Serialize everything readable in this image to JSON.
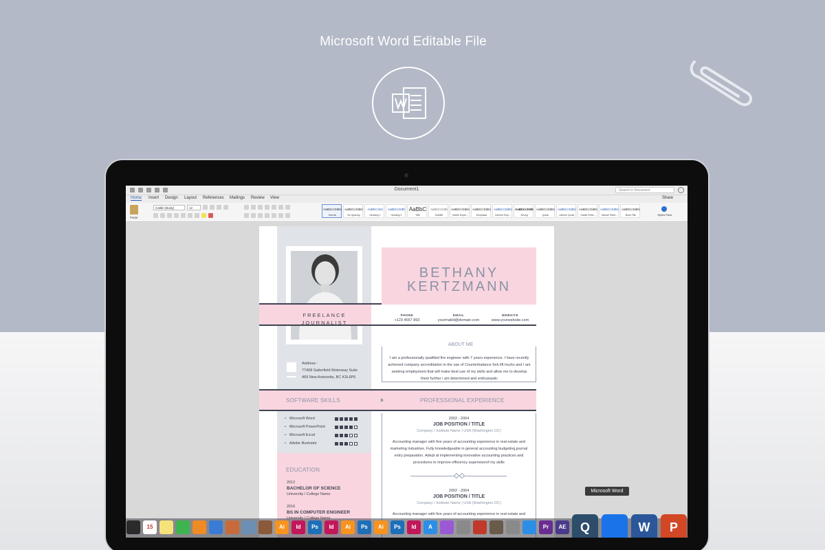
{
  "promo": {
    "headline": "Microsoft Word Editable File"
  },
  "app": {
    "document_title": "Document1",
    "search_placeholder": "Search in Document",
    "share_label": "Share",
    "tabs": [
      {
        "label": "Home"
      },
      {
        "label": "Insert"
      },
      {
        "label": "Design"
      },
      {
        "label": "Layout"
      },
      {
        "label": "References"
      },
      {
        "label": "Mailings"
      },
      {
        "label": "Review"
      },
      {
        "label": "View"
      }
    ],
    "paste_label": "Paste",
    "font_name": "Calibri (Body)",
    "font_size": "12",
    "styles": [
      {
        "sample": "AaBbCcDdEe",
        "name": "Normal"
      },
      {
        "sample": "AaBbCcDdEe",
        "name": "No Spacing"
      },
      {
        "sample": "AaBbCcDd",
        "name": "Heading 1"
      },
      {
        "sample": "AaBbCcDdE",
        "name": "Heading 2"
      },
      {
        "sample": "AaBbC",
        "name": "Title"
      },
      {
        "sample": "AaBbCcDdE",
        "name": "Subtitle"
      },
      {
        "sample": "AaBbCcDdEe",
        "name": "Subtle Emph..."
      },
      {
        "sample": "AaBbCcDdEe",
        "name": "Emphasis"
      },
      {
        "sample": "AaBbCcDdEe",
        "name": "Intense Emp..."
      },
      {
        "sample": "AaBbCcDdEe",
        "name": "Strong"
      },
      {
        "sample": "AaBbCcDdEe",
        "name": "Quote"
      },
      {
        "sample": "AaBbCcDdEe",
        "name": "Intense Quote"
      },
      {
        "sample": "AaBbCcDdEe",
        "name": "Subtle Refer..."
      },
      {
        "sample": "AaBbCcDdEe",
        "name": "Intense Refer..."
      },
      {
        "sample": "AaBbCcDdEe",
        "name": "Book Title"
      }
    ],
    "styles_pane_label": "Styles Pane"
  },
  "resume": {
    "first_name": "BETHANY",
    "last_name": "KERTZMANN",
    "role_line1": "FREELANCE",
    "role_line2": "JOURNALIST",
    "phone_label": "PHONE",
    "phone": "+123 4567 893",
    "email_label": "EMAIL",
    "email": "yourmailid@domain.com",
    "website_label": "WEBSITE",
    "website": "www.yourwebsite.com",
    "about_title": "ABOUT ME",
    "about_text": "I am a professionally qualified fire engineer with 7 years experience. I have recently achieved company accreditation in the use of Counterbalance fork lift trucks and I am seeking employment that will make best use of my skills and allow me to develop them further i am determined and enthusiastic",
    "address_label": "Address :",
    "address_line1": "77408 Satterfield Motorway Suite",
    "address_line2": "469 New Antonetta, BC K3L6P6",
    "software_title": "SOFTWARE SKILLS",
    "experience_title": "PROFESSIONAL EXPERIENCE",
    "skills": [
      {
        "name": "Microsoft Word",
        "level": 5
      },
      {
        "name": "Microsoft PowerPoint",
        "level": 4
      },
      {
        "name": "Microsoft Excel",
        "level": 3
      },
      {
        "name": "Adobe Illustrator",
        "level": 3
      }
    ],
    "education_title": "EDUCATION",
    "education": [
      {
        "year": "2012",
        "degree": "BACHELOR OF SCIENCE",
        "school": "University / College Name"
      },
      {
        "year": "2016",
        "degree": "BS IN COMPUTER ENGINEER",
        "school": "University / College Name"
      }
    ],
    "jobs": [
      {
        "years": "2002 - 2004",
        "title": "JOB POSITION / TITLE",
        "company": "Company / Institute Name   |   USA (Washington DC)",
        "desc": "Accounting manager with five years of accounting experience in real estate and marketing industries. Fully knowledgeable in general accounting budgeting,journal entry preparation. Adept at implementing innovative accounting practices and procedures to improve efficiency supervisorof my skills"
      },
      {
        "years": "2002 - 2004",
        "title": "JOB POSITION / TITLE",
        "company": "Company / Institute Name   |   USA (Washington DC)",
        "desc": "Accounting manager with five years of accounting experience in real estate and"
      }
    ]
  },
  "dock": {
    "tooltip": "Microsoft Word",
    "apps": [
      {
        "icon": "imovie-icon",
        "label": "",
        "color": "#2b2b2b"
      },
      {
        "icon": "calendar-icon",
        "label": "15",
        "color": "#ffffff"
      },
      {
        "icon": "notes-icon",
        "label": "",
        "color": "#f6e27a"
      },
      {
        "icon": "facetime-icon",
        "label": "",
        "color": "#3fb34f"
      },
      {
        "icon": "vlc-icon",
        "label": "",
        "color": "#f08a24"
      },
      {
        "icon": "keynote-icon",
        "label": "",
        "color": "#3a7bd5"
      },
      {
        "icon": "presentation-icon",
        "label": "",
        "color": "#c96a3a"
      },
      {
        "icon": "preview-icon",
        "label": "",
        "color": "#6b8fb5"
      },
      {
        "icon": "library-icon",
        "label": "",
        "color": "#8a5a3a"
      },
      {
        "icon": "illustrator-icon",
        "label": "Ai",
        "color": "#f7931e"
      },
      {
        "icon": "indesign-icon",
        "label": "Id",
        "color": "#c2185b"
      },
      {
        "icon": "photoshop-icon",
        "label": "Ps",
        "color": "#1d6fb8"
      },
      {
        "icon": "indesign-icon",
        "label": "Id",
        "color": "#c2185b"
      },
      {
        "icon": "illustrator-icon",
        "label": "Ai",
        "color": "#f7931e"
      },
      {
        "icon": "photoshop-icon",
        "label": "Ps",
        "color": "#1d6fb8"
      },
      {
        "icon": "illustrator-icon",
        "label": "Ai",
        "color": "#f7931e"
      },
      {
        "icon": "photoshop-icon",
        "label": "Ps",
        "color": "#1d6fb8"
      },
      {
        "icon": "indesign-icon",
        "label": "Id",
        "color": "#c2185b"
      },
      {
        "icon": "app-store-icon",
        "label": "A",
        "color": "#2d8ee6"
      },
      {
        "icon": "itunes-icon",
        "label": "",
        "color": "#9b59d6"
      },
      {
        "icon": "settings-icon",
        "label": "",
        "color": "#8a8a8a"
      },
      {
        "icon": "filezilla-icon",
        "label": "",
        "color": "#c0392b"
      },
      {
        "icon": "photo-icon",
        "label": "",
        "color": "#6a5a4a"
      },
      {
        "icon": "disk-icon",
        "label": "",
        "color": "#8a8a8a"
      },
      {
        "icon": "sync-icon",
        "label": "",
        "color": "#2d8ee6"
      },
      {
        "icon": "premiere-icon",
        "label": "Pr",
        "color": "#6a2d91"
      },
      {
        "icon": "after-effects-icon",
        "label": "AE",
        "color": "#4a3a8a"
      },
      {
        "icon": "quicktime-icon",
        "label": "Q",
        "color": "#2d4d6a"
      },
      {
        "icon": "teamviewer-icon",
        "label": "",
        "color": "#1a73e8"
      },
      {
        "icon": "word-icon",
        "label": "W",
        "color": "#2b579a"
      },
      {
        "icon": "powerpoint-icon",
        "label": "P",
        "color": "#d24726"
      },
      {
        "icon": "parrot-icon",
        "label": "",
        "color": "#4caf50"
      }
    ]
  }
}
